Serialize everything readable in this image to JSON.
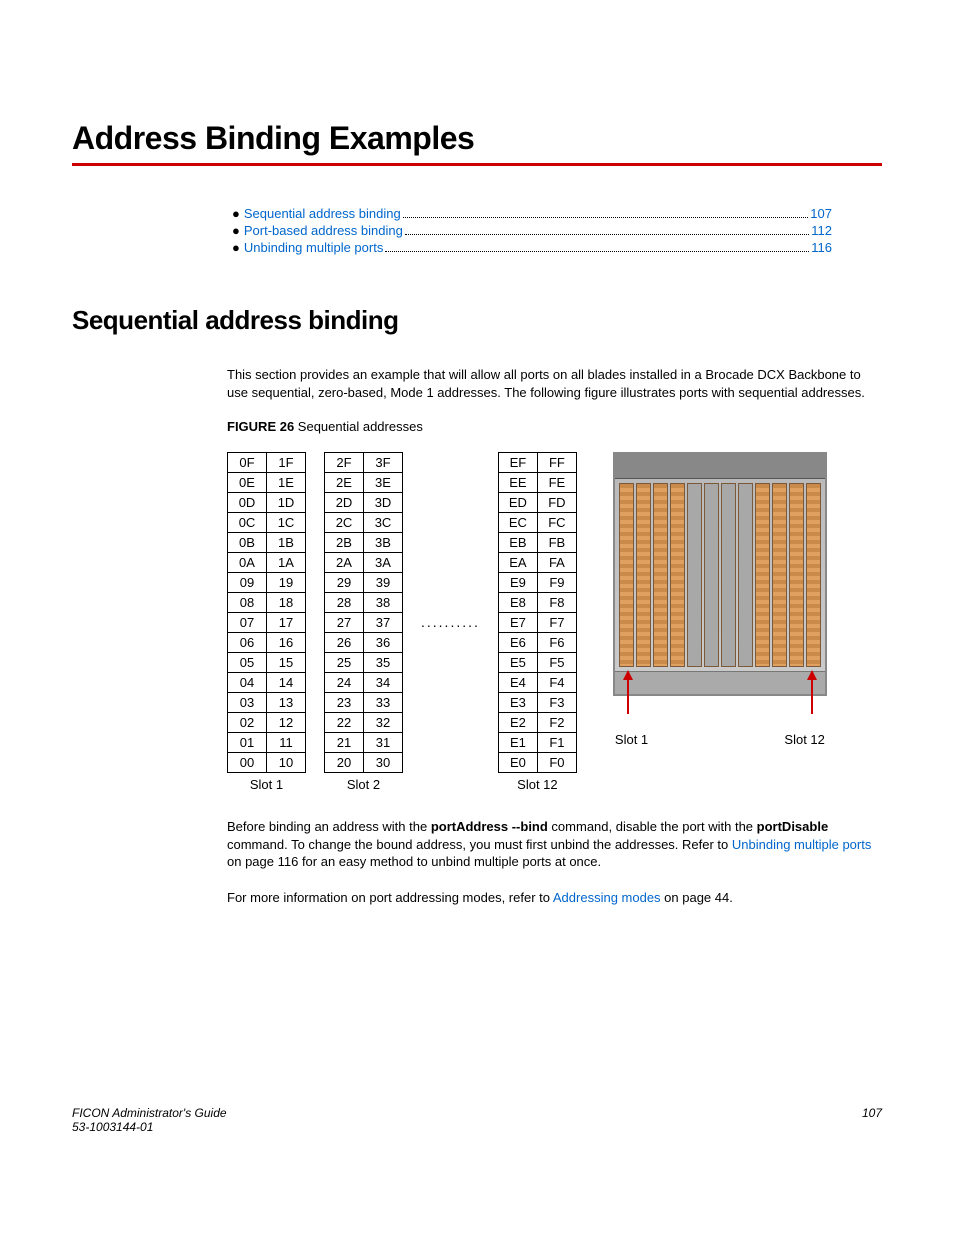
{
  "title": "Address Binding Examples",
  "toc": [
    {
      "label": "Sequential address binding",
      "page": "107"
    },
    {
      "label": "Port-based address binding",
      "page": "112"
    },
    {
      "label": "Unbinding multiple ports",
      "page": "116"
    }
  ],
  "section_heading": "Sequential address binding",
  "intro_para": "This section provides an example that will allow all ports on all blades installed in a Brocade DCX Backbone to use sequential, zero-based, Mode 1 addresses. The following figure illustrates ports with sequential addresses.",
  "figure_label_bold": "FIGURE 26",
  "figure_label_rest": " Sequential addresses",
  "slots": [
    {
      "label": "Slot 1",
      "rows": [
        [
          "0F",
          "1F"
        ],
        [
          "0E",
          "1E"
        ],
        [
          "0D",
          "1D"
        ],
        [
          "0C",
          "1C"
        ],
        [
          "0B",
          "1B"
        ],
        [
          "0A",
          "1A"
        ],
        [
          "09",
          "19"
        ],
        [
          "08",
          "18"
        ],
        [
          "07",
          "17"
        ],
        [
          "06",
          "16"
        ],
        [
          "05",
          "15"
        ],
        [
          "04",
          "14"
        ],
        [
          "03",
          "13"
        ],
        [
          "02",
          "12"
        ],
        [
          "01",
          "11"
        ],
        [
          "00",
          "10"
        ]
      ]
    },
    {
      "label": "Slot 2",
      "rows": [
        [
          "2F",
          "3F"
        ],
        [
          "2E",
          "3E"
        ],
        [
          "2D",
          "3D"
        ],
        [
          "2C",
          "3C"
        ],
        [
          "2B",
          "3B"
        ],
        [
          "2A",
          "3A"
        ],
        [
          "29",
          "39"
        ],
        [
          "28",
          "38"
        ],
        [
          "27",
          "37"
        ],
        [
          "26",
          "36"
        ],
        [
          "25",
          "35"
        ],
        [
          "24",
          "34"
        ],
        [
          "23",
          "33"
        ],
        [
          "22",
          "32"
        ],
        [
          "21",
          "31"
        ],
        [
          "20",
          "30"
        ]
      ]
    },
    {
      "label": "Slot 12",
      "rows": [
        [
          "EF",
          "FF"
        ],
        [
          "EE",
          "FE"
        ],
        [
          "ED",
          "FD"
        ],
        [
          "EC",
          "FC"
        ],
        [
          "EB",
          "FB"
        ],
        [
          "EA",
          "FA"
        ],
        [
          "E9",
          "F9"
        ],
        [
          "E8",
          "F8"
        ],
        [
          "E7",
          "F7"
        ],
        [
          "E6",
          "F6"
        ],
        [
          "E5",
          "F5"
        ],
        [
          "E4",
          "F4"
        ],
        [
          "E3",
          "F3"
        ],
        [
          "E2",
          "F2"
        ],
        [
          "E1",
          "F1"
        ],
        [
          "E0",
          "F0"
        ]
      ]
    }
  ],
  "ellipsis": "..........",
  "chassis_labels": {
    "left": "Slot 1",
    "right": "Slot 12"
  },
  "para2_pre": "Before binding an address with the ",
  "para2_cmd1": "portAddress --bind",
  "para2_mid1": " command, disable the port with the ",
  "para2_cmd2": "portDisable",
  "para2_mid2": " command. To change the bound address, you must first unbind the addresses. Refer to ",
  "para2_link": "Unbinding multiple ports",
  "para2_post": " on page 116 for an easy method to unbind multiple ports at once.",
  "para3_pre": "For more information on port addressing modes, refer to ",
  "para3_link": "Addressing modes",
  "para3_post": " on page 44.",
  "footer": {
    "guide": "FICON Administrator's Guide",
    "docnum": "53-1003144-01",
    "page": "107"
  }
}
